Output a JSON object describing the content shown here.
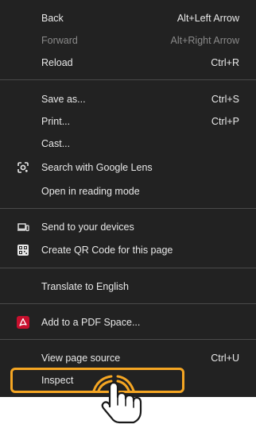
{
  "menu": {
    "groups": [
      {
        "items": [
          {
            "label": "Back",
            "shortcut": "Alt+Left Arrow"
          },
          {
            "label": "Forward",
            "shortcut": "Alt+Right Arrow"
          },
          {
            "label": "Reload",
            "shortcut": "Ctrl+R"
          }
        ]
      },
      {
        "items": [
          {
            "label": "Save as...",
            "shortcut": "Ctrl+S"
          },
          {
            "label": "Print...",
            "shortcut": "Ctrl+P"
          },
          {
            "label": "Cast..."
          },
          {
            "label": "Search with Google Lens",
            "icon": "google-lens-icon"
          },
          {
            "label": "Open in reading mode"
          }
        ]
      },
      {
        "items": [
          {
            "label": "Send to your devices",
            "icon": "devices-icon"
          },
          {
            "label": "Create QR Code for this page",
            "icon": "qr-code-icon"
          }
        ]
      },
      {
        "items": [
          {
            "label": "Translate to English"
          }
        ]
      },
      {
        "items": [
          {
            "label": "Add to a PDF Space...",
            "icon": "adobe-acrobat-icon"
          }
        ]
      },
      {
        "items": [
          {
            "label": "View page source",
            "shortcut": "Ctrl+U"
          },
          {
            "label": "Inspect"
          }
        ]
      }
    ]
  },
  "colors": {
    "menu_bg": "#222222",
    "text": "#e8e8e8",
    "disabled_text": "#8a8a8a",
    "separator": "#4a4a4a",
    "highlight": "#f5a623",
    "acrobat_red": "#c8102e"
  }
}
